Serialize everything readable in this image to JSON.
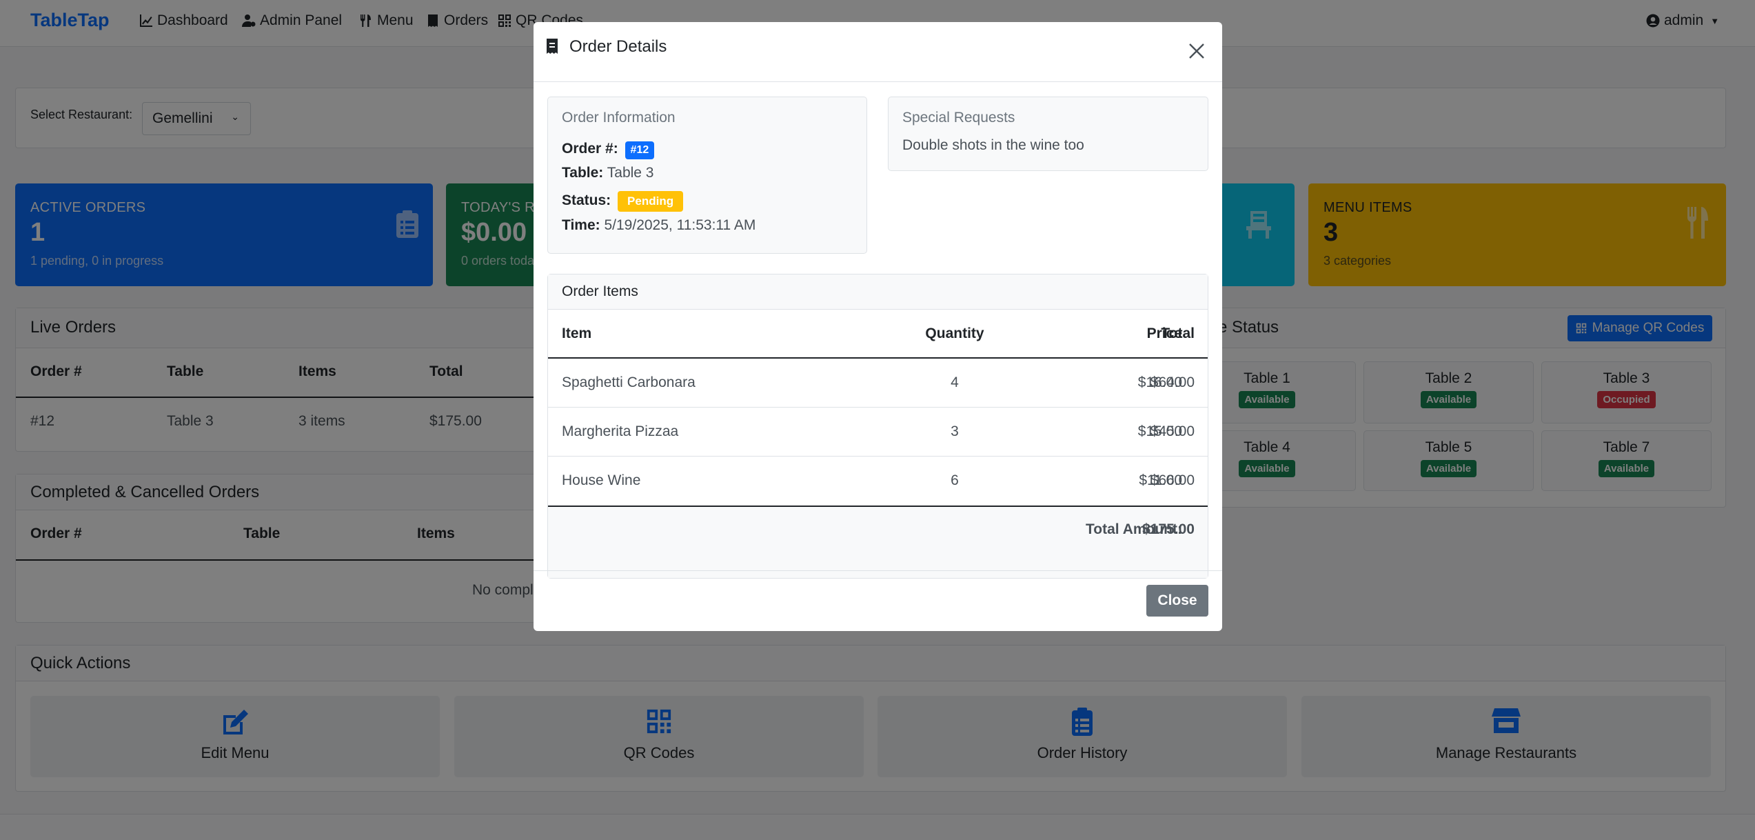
{
  "nav": {
    "brand": "TableTap",
    "links": [
      "Dashboard",
      "Admin Panel",
      "Menu",
      "Orders",
      "QR Codes"
    ],
    "user": "admin"
  },
  "restaurant": {
    "label": "Select Restaurant:",
    "selected": "Gemellini"
  },
  "cards": {
    "active": {
      "title": "ACTIVE ORDERS",
      "value": "1",
      "sub": "1 pending, 0 in progress"
    },
    "revenue": {
      "title": "TODAY'S R",
      "value": "$0.00",
      "sub": "0 orders toda"
    },
    "menu": {
      "title": "MENU ITEMS",
      "value": "3",
      "sub": "3 categories"
    }
  },
  "live_orders": {
    "title": "Live Orders",
    "headers": [
      "Order #",
      "Table",
      "Items",
      "Total"
    ],
    "rows": [
      [
        "#12",
        "Table 3",
        "3 items",
        "$175.00"
      ]
    ]
  },
  "completed": {
    "title": "Completed & Cancelled Orders",
    "headers": [
      "Order #",
      "Table",
      "Items"
    ],
    "empty": "No compl"
  },
  "table_status": {
    "title": "e Status",
    "button": "Manage QR Codes",
    "tables": [
      {
        "name": "Table 1",
        "status": "Available"
      },
      {
        "name": "Table 2",
        "status": "Available"
      },
      {
        "name": "Table 3",
        "status": "Occupied"
      },
      {
        "name": "Table 4",
        "status": "Available"
      },
      {
        "name": "Table 5",
        "status": "Available"
      },
      {
        "name": "Table 7",
        "status": "Available"
      }
    ]
  },
  "quick_actions": {
    "title": "Quick Actions",
    "items": [
      "Edit Menu",
      "QR Codes",
      "Order History",
      "Manage Restaurants"
    ]
  },
  "modal": {
    "title": "Order Details",
    "info_title": "Order Information",
    "order_label": "Order #:",
    "order_value": "#12",
    "table_label": "Table:",
    "table_value": "Table 3",
    "status_label": "Status:",
    "status_value": "Pending",
    "time_label": "Time:",
    "time_value": "5/19/2025, 11:53:11 AM",
    "special_title": "Special Requests",
    "special_text": "Double shots in the wine too",
    "items_title": "Order Items",
    "headers": [
      "Item",
      "Quantity",
      "Price",
      "Total"
    ],
    "items": [
      {
        "name": "Spaghetti Carbonara",
        "qty": "4",
        "price": "$16.00",
        "total": "$64.00"
      },
      {
        "name": "Margherita Pizzaa",
        "qty": "3",
        "price": "$15.00",
        "total": "$45.00"
      },
      {
        "name": "House Wine",
        "qty": "6",
        "price": "$11.00",
        "total": "$66.00"
      }
    ],
    "total_label": "Total Amount:",
    "total_value": "$175.00",
    "close": "Close"
  },
  "colors": {
    "primary": "#0d6efd",
    "success": "#198754",
    "cyan": "#0dcaf0",
    "warning": "#ffc107",
    "danger": "#dc3545",
    "secondary": "#6c757d"
  }
}
